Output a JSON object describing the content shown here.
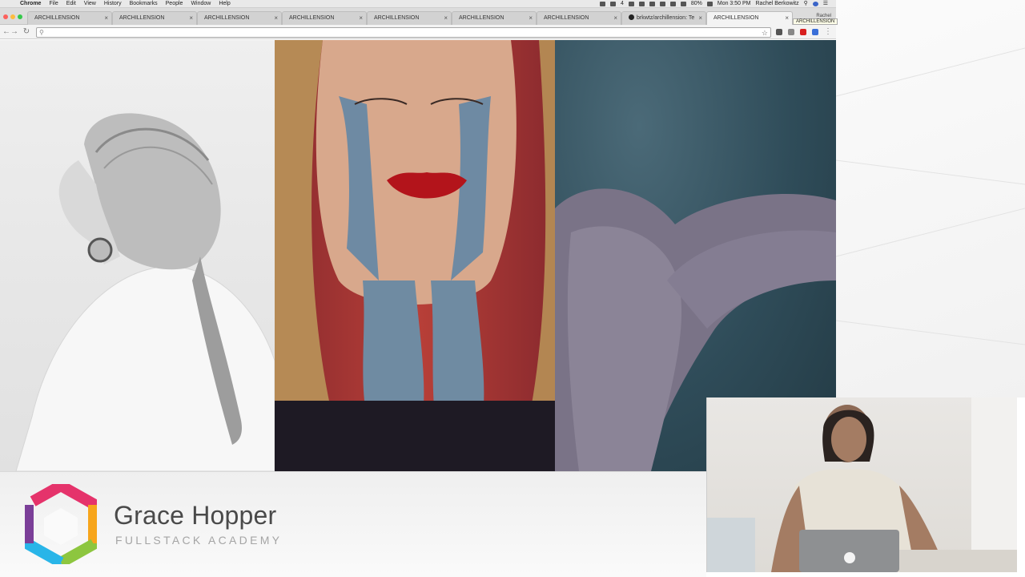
{
  "menubar": {
    "app_name": "Chrome",
    "menus": [
      "File",
      "Edit",
      "View",
      "History",
      "Bookmarks",
      "People",
      "Window",
      "Help"
    ],
    "status": {
      "badge_count": "4",
      "battery": "80%",
      "clock": "Mon 3:50 PM",
      "user": "Rachel Berkowitz"
    }
  },
  "tabs": [
    {
      "label": "ARCHILLENSION"
    },
    {
      "label": "ARCHILLENSION"
    },
    {
      "label": "ARCHILLENSION"
    },
    {
      "label": "ARCHILLENSION"
    },
    {
      "label": "ARCHILLENSION"
    },
    {
      "label": "ARCHILLENSION"
    },
    {
      "label": "ARCHILLENSION"
    },
    {
      "label": "brkwtz/archillension: Te"
    },
    {
      "label": "ARCHILLENSION",
      "active": true
    }
  ],
  "tab_close_glyph": "×",
  "profile_label": "Rachel",
  "tooltip": "ARCHILLENSION",
  "toolbar": {
    "back_glyph": "←",
    "forward_glyph": "→",
    "reload_glyph": "↻",
    "omnibox_value": "",
    "search_glyph": "⚲",
    "star_glyph": "☆"
  },
  "banner": {
    "title": "Grace Hopper",
    "subtitle": "FULLSTACK ACADEMY",
    "logo_colors": [
      "#e5336b",
      "#f7a51b",
      "#8dc63f",
      "#29b5e8",
      "#7b3f98"
    ]
  },
  "photos": [
    {
      "icon": "photo-profile-woman-bw"
    },
    {
      "icon": "photo-face-painted"
    },
    {
      "icon": "photo-knee-underwater"
    }
  ]
}
